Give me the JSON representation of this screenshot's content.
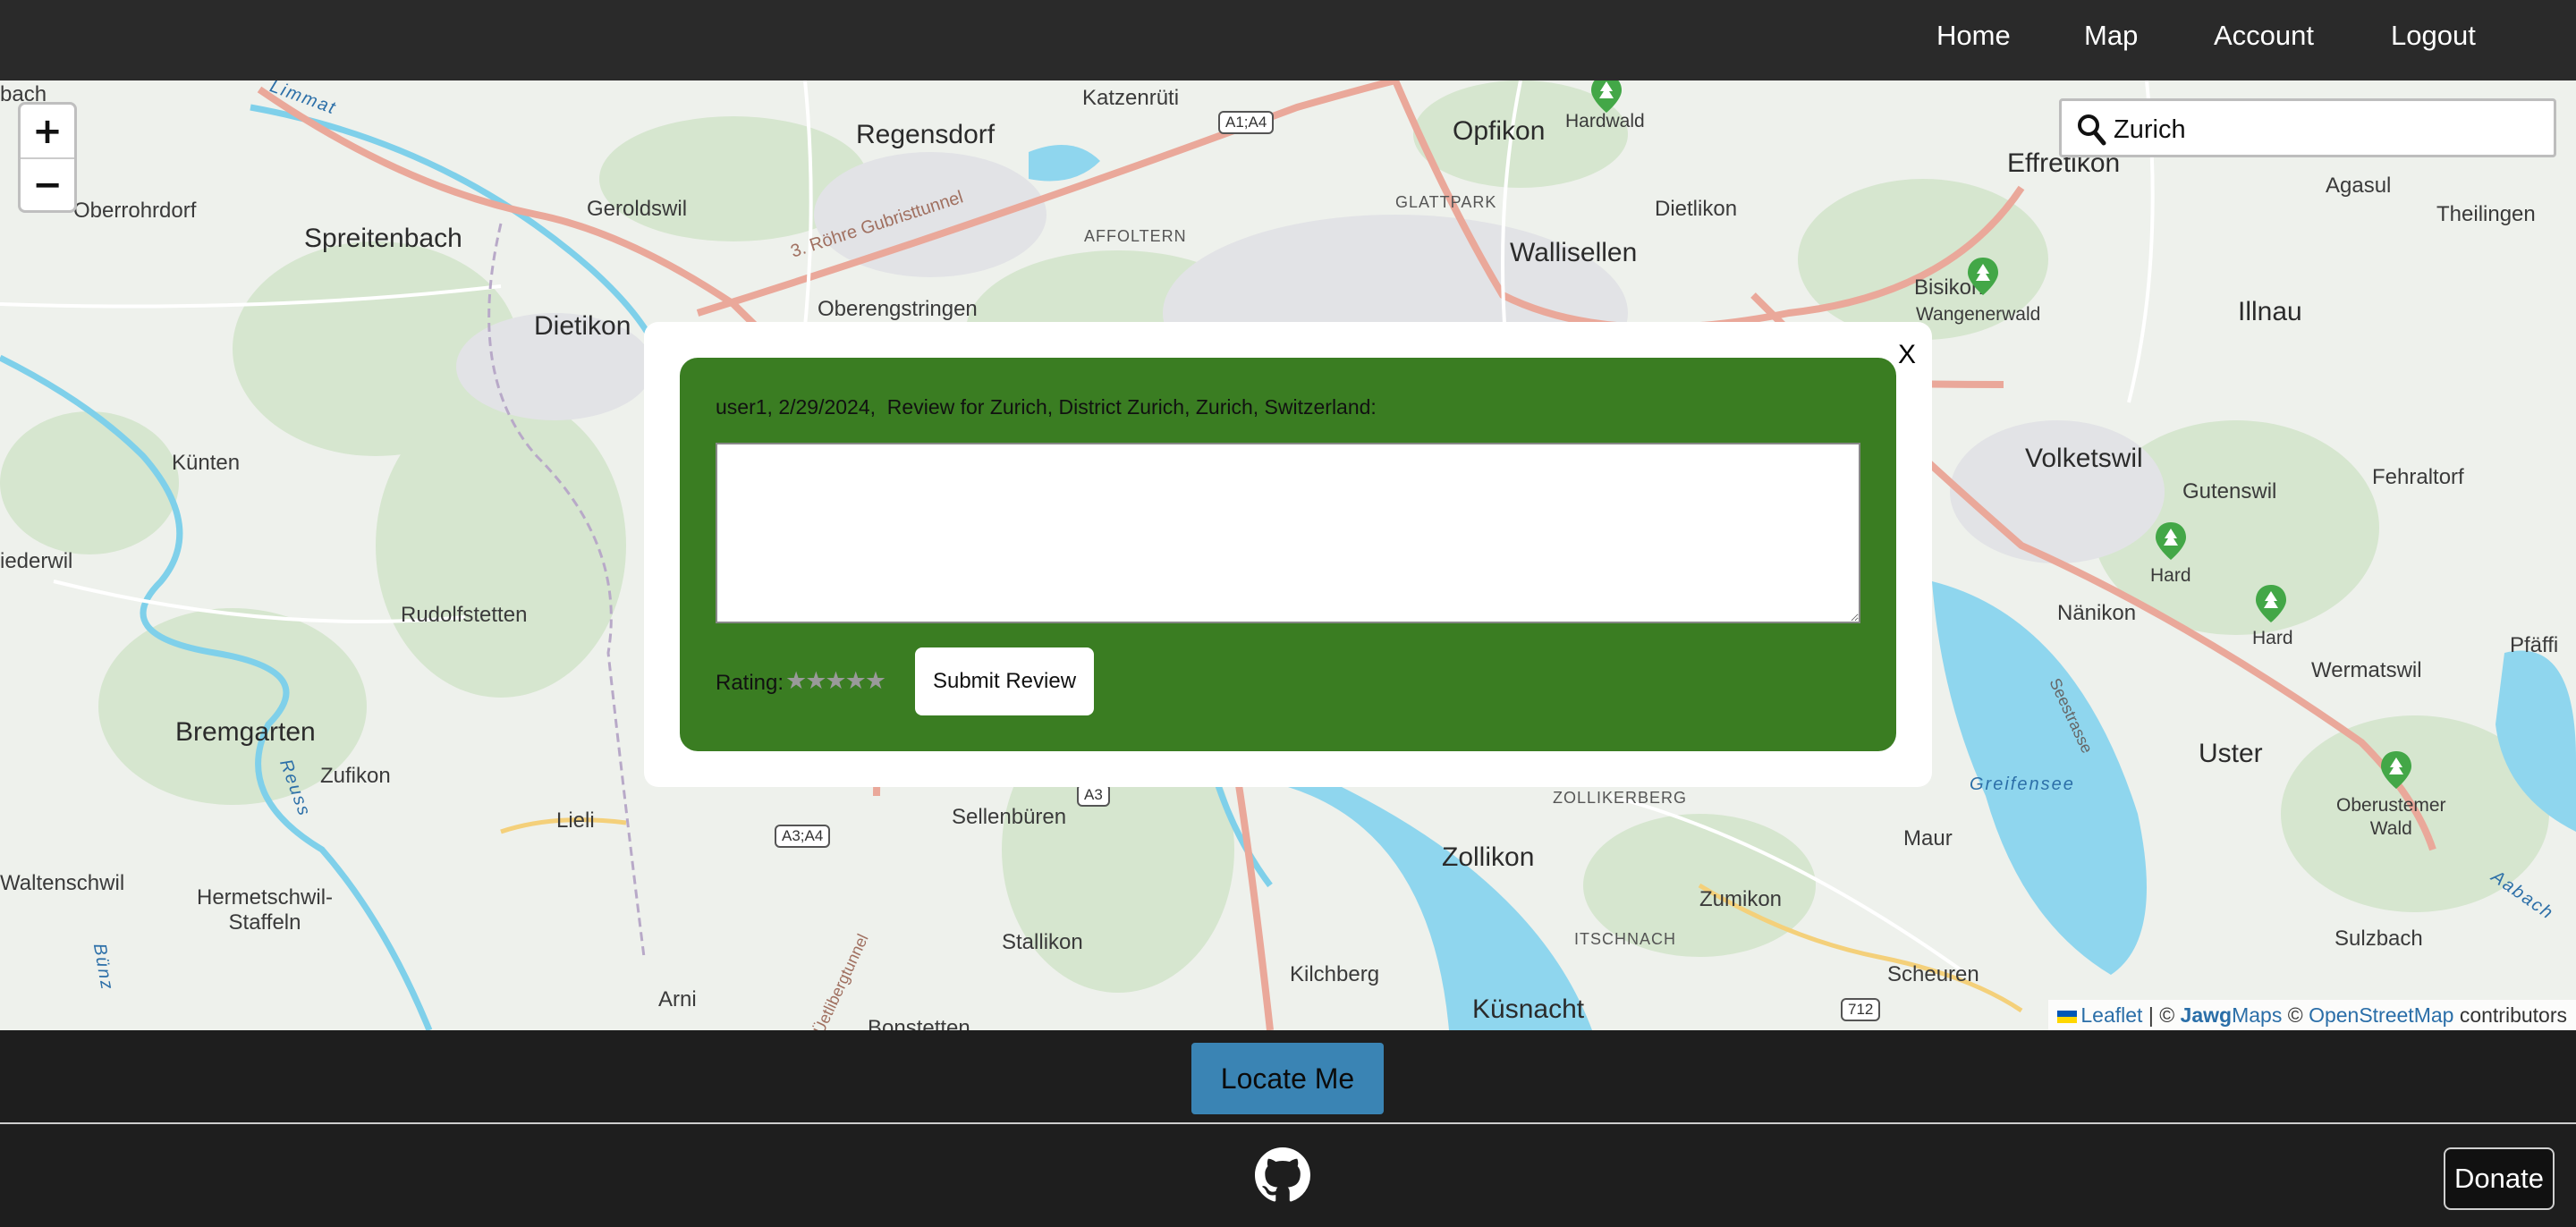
{
  "nav": {
    "home": "Home",
    "map": "Map",
    "account": "Account",
    "logout": "Logout"
  },
  "map": {
    "zoom_in": "+",
    "zoom_out": "−",
    "search_value": "Zurich",
    "places": {
      "regensdorf": "Regensdorf",
      "katzenruti": "Katzenrüti",
      "opfikon": "Opfikon",
      "hardwald": "Hardwald",
      "effretikon": "Effretikon",
      "oberrohrdorf": "Oberrohrdorf",
      "spreitenbach": "Spreitenbach",
      "geroldswil": "Geroldswil",
      "affoltern": "AFFOLTERN",
      "glattpark": "GLATTPARK",
      "dietlikon": "Dietlikon",
      "agasul": "Agasul",
      "theilingen": "Theilingen",
      "wallisellen": "Wallisellen",
      "dietikon": "Dietikon",
      "oberengstringen": "Oberengstringen",
      "bisikon": "Bisikon",
      "wangenerwald": "Wangenerwald",
      "illnau": "Illnau",
      "kunten": "Künten",
      "volketswil": "Volketswil",
      "gutenswil": "Gutenswil",
      "fehraltorf": "Fehraltorf",
      "niederwil": "iederwil",
      "hard1": "Hard",
      "hard2": "Hard",
      "nanikon": "Nänikon",
      "rudolfstetten": "Rudolfstetten",
      "wermatswil": "Wermatswil",
      "pfaffikon": "Pfäffi",
      "bremgarten": "Bremgarten",
      "uster": "Uster",
      "zufikon": "Zufikon",
      "lieli": "Lieli",
      "sellenburen": "Sellenbüren",
      "zollikerberg": "ZOLLIKERBERG",
      "zollikon": "Zollikon",
      "maur": "Maur",
      "oberustermer_wald": "Oberustemer\nWald",
      "waltenschwil": "Waltenschwil",
      "hermetschwil": "Hermetschwil-\nStaffeln",
      "zumikon": "Zumikon",
      "stallikon": "Stallikon",
      "itschnach": "ITSCHNACH",
      "sulzbach": "Sulzbach",
      "arni": "Arni",
      "kilchberg": "Kilchberg",
      "scheuren": "Scheuren",
      "kusnacht": "Küsnacht",
      "bonstetten": "Bonstetten",
      "bach": "bach"
    },
    "water_labels": {
      "limmat": "Limmat",
      "reuss": "Reuss",
      "greifensee": "Greifensee",
      "aabach": "Aabach",
      "bunz": "Bünz",
      "seestrasse": "Seestrasse"
    },
    "road_labels": {
      "gubrist": "3. Röhre Gubristtunnel",
      "uetliberg": "Üetlibergtunnel"
    },
    "shields": {
      "a1a4": "A1;A4",
      "a3": "A3",
      "a3a4": "A3;A4",
      "r712": "712"
    },
    "attribution": {
      "leaflet": "Leaflet",
      "sep": " | © ",
      "jawg_bold": "Jawg",
      "jawg_rest": "Maps",
      "copy": " © ",
      "osm": "OpenStreetMap",
      "contributors": " contributors"
    }
  },
  "review_modal": {
    "close_label": "X",
    "heading": "user1, 2/29/2024,  Review for Zurich, District Zurich, Zurich, Switzerland:",
    "textarea_value": "",
    "rating_label": "Rating:",
    "stars": "★★★★★",
    "rating_value": 0,
    "submit_label": "Submit Review"
  },
  "locate_button": "Locate Me",
  "footer": {
    "github_icon": "github-icon",
    "donate_label": "Donate"
  },
  "colors": {
    "nav_bg": "#2a2a2a",
    "panel_green": "#3a7d22",
    "locate_blue": "#3a84b4",
    "water": "#8fd6ee"
  }
}
